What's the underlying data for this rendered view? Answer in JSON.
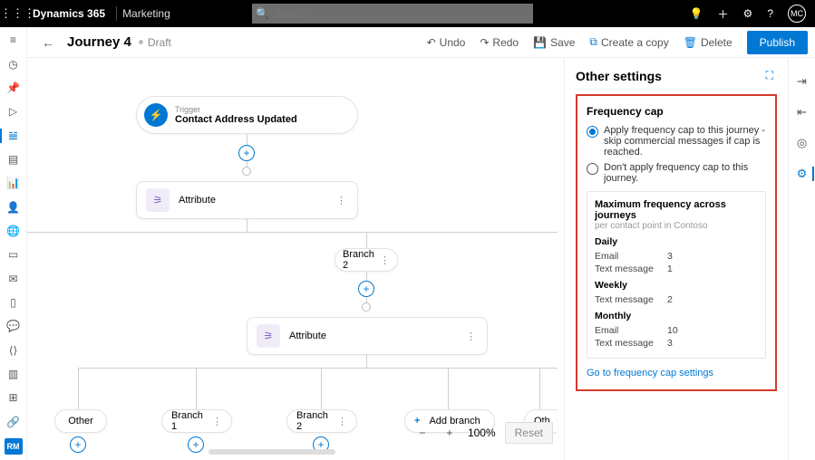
{
  "header": {
    "brand": "Dynamics 365",
    "module": "Marketing",
    "searchPlaceholder": "Search",
    "avatar": "MC"
  },
  "page": {
    "title": "Journey 4",
    "status": "Draft"
  },
  "commands": {
    "undo": "Undo",
    "redo": "Redo",
    "save": "Save",
    "copy": "Create a copy",
    "delete": "Delete",
    "publish": "Publish"
  },
  "flow": {
    "trigger": {
      "label": "Trigger",
      "name": "Contact Address Updated"
    },
    "attribute": "Attribute",
    "branch2": "Branch 2",
    "other": "Other",
    "branch1": "Branch 1",
    "addBranch": "Add branch",
    "otherR": "Oth"
  },
  "zoom": {
    "value": "100%",
    "reset": "Reset"
  },
  "panel": {
    "title": "Other settings",
    "freqTitle": "Frequency cap",
    "opt1": "Apply frequency cap to this journey - skip commercial messages if cap is reached.",
    "opt2": "Don't apply frequency cap to this journey.",
    "maxTitle": "Maximum frequency across journeys",
    "maxSub": "per contact point in Contoso",
    "groups": [
      {
        "name": "Daily",
        "rows": [
          {
            "k": "Email",
            "v": "3"
          },
          {
            "k": "Text message",
            "v": "1"
          }
        ]
      },
      {
        "name": "Weekly",
        "rows": [
          {
            "k": "Text message",
            "v": "2"
          }
        ]
      },
      {
        "name": "Monthly",
        "rows": [
          {
            "k": "Email",
            "v": "10"
          },
          {
            "k": "Text message",
            "v": "3"
          }
        ]
      }
    ],
    "link": "Go to frequency cap settings"
  },
  "rail": {
    "rm": "RM"
  }
}
